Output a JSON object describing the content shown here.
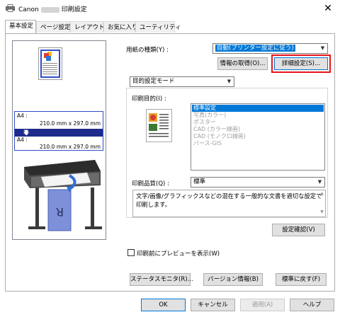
{
  "window": {
    "title_prefix": "Canon",
    "title_suffix": "印刷設定",
    "close_glyph": "✕"
  },
  "tabs": [
    {
      "label": "基本設定"
    },
    {
      "label": "ページ設定"
    },
    {
      "label": "レイアウト"
    },
    {
      "label": "お気に入り"
    },
    {
      "label": "ユーティリティ"
    }
  ],
  "preview": {
    "size_rows": [
      {
        "name": "A4 :",
        "dim": "210.0 mm x 297.0 mm"
      },
      {
        "equal": "等倍"
      },
      {
        "name": "A4 :",
        "dim": "210.0 mm x 297.0 mm"
      }
    ],
    "printed_letter": "R"
  },
  "paper_type": {
    "label": "用紙の種類(Y) :",
    "value": "自動(プリンター設定に従う)"
  },
  "buttons": {
    "get_info": "情報の取得(O)...",
    "detailed_settings": "詳細設定(S)...",
    "check_settings": "設定確認(V)",
    "status_monitor": "ステータスモニタ(R)...",
    "version_info": "バージョン情報(B)",
    "restore_defaults": "標準に戻す(F)",
    "ok": "OK",
    "cancel": "キャンセル",
    "apply": "適用(A)",
    "help": "ヘルプ"
  },
  "mode": {
    "value": "目的設定モード"
  },
  "purpose": {
    "label": "印刷目的(I) :",
    "items": [
      "標準設定",
      "写真(カラー)",
      "ポスター",
      "CAD (カラー線画)",
      "CAD (モノクロ線画)",
      "パース-GIS"
    ],
    "selected_index": 0
  },
  "quality": {
    "label": "印刷品質(Q) :",
    "value": "標準"
  },
  "description": "文字/画像/グラフィックスなどの混在する一般的な文書を適切な設定で印刷します。",
  "preview_checkbox": {
    "label": "印刷前にプレビューを表示(W)",
    "checked": false
  }
}
